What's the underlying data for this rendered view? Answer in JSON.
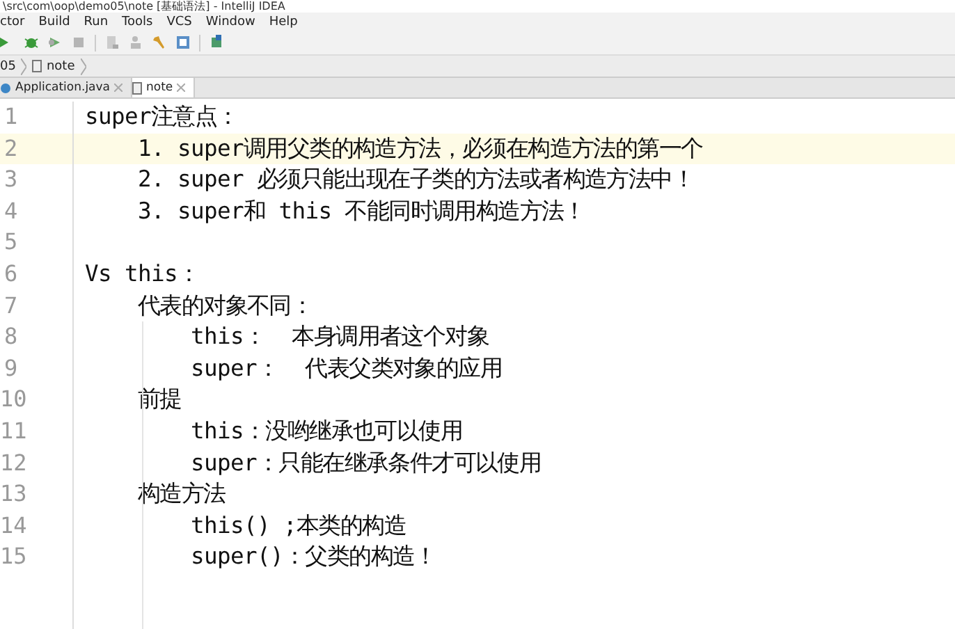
{
  "window": {
    "title": "\\src\\com\\oop\\demo05\\note [基础语法] - IntelliJ IDEA"
  },
  "menu": [
    "ctor",
    "Build",
    "Run",
    "Tools",
    "VCS",
    "Window",
    "Help"
  ],
  "breadcrumb": [
    "05",
    "note"
  ],
  "tabs": [
    {
      "label": "Application.java",
      "selected": false
    },
    {
      "label": "note",
      "selected": true
    }
  ],
  "editor": {
    "lines": [
      {
        "number": "1",
        "text": "super注意点：",
        "current": false
      },
      {
        "number": "2",
        "text": "    1. super调用父类的构造方法，必须在构造方法的第一个",
        "current": true
      },
      {
        "number": "3",
        "text": "    2. super 必须只能出现在子类的方法或者构造方法中！",
        "current": false
      },
      {
        "number": "4",
        "text": "    3. super和 this 不能同时调用构造方法！",
        "current": false
      },
      {
        "number": "5",
        "current": false
      },
      {
        "number": "6",
        "text": "Vs this：",
        "current": false
      },
      {
        "number": "7",
        "text": "    代表的对象不同：",
        "current": false
      },
      {
        "number": "8",
        "text": "        this：  本身调用者这个对象",
        "current": false
      },
      {
        "number": "9",
        "text": "        super：  代表父类对象的应用",
        "current": false
      },
      {
        "number": "10",
        "text": "    前提",
        "current": false
      },
      {
        "number": "11",
        "text": "        this：没哟继承也可以使用",
        "current": false
      },
      {
        "number": "12",
        "text": "        super：只能在继承条件才可以使用",
        "current": false
      },
      {
        "number": "13",
        "text": "    构造方法",
        "current": false
      },
      {
        "number": "14",
        "text": "        this() ;本类的构造",
        "current": false
      },
      {
        "number": "15",
        "text": "        super()：父类的构造！",
        "current": false
      }
    ]
  }
}
